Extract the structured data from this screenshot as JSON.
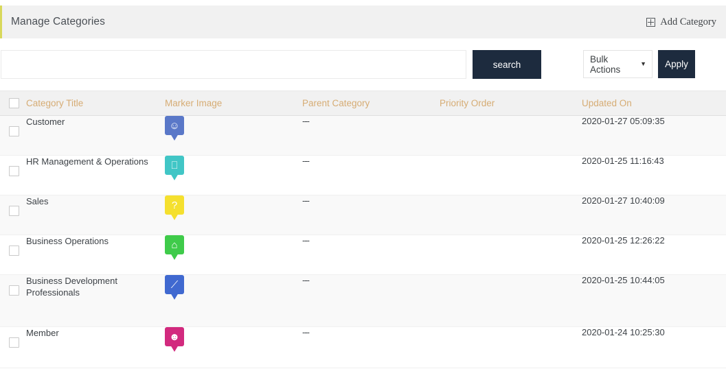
{
  "header": {
    "title": "Manage Categories",
    "add_label": "Add Category",
    "add_icon": "plus-square-icon",
    "accent_color": "#d8d85a",
    "bg_color": "#f1f1f1"
  },
  "filters": {
    "search_value": "",
    "search_placeholder": "",
    "search_button": "search",
    "bulk_actions_label": "Bulk Actions",
    "bulk_caret_icon": "chevron-down-icon",
    "apply_button": "Apply",
    "button_color": "#1d2b3e"
  },
  "table": {
    "header_text_color": "#d6ac74",
    "columns": [
      {
        "key": "select",
        "label": ""
      },
      {
        "key": "title",
        "label": "Category Title"
      },
      {
        "key": "marker",
        "label": "Marker Image"
      },
      {
        "key": "parent",
        "label": "Parent Category"
      },
      {
        "key": "priority",
        "label": "Priority Order"
      },
      {
        "key": "updated",
        "label": "Updated On"
      }
    ],
    "rows": [
      {
        "title": "Customer",
        "marker_icon": "pin-face-icon",
        "marker_color": "#5a78c8",
        "marker_glyph": "☺",
        "parent": "---",
        "priority": "",
        "updated": "2020-01-27 05:09:35"
      },
      {
        "title": "HR Management & Operations",
        "marker_icon": "pin-computer-icon",
        "marker_color": "#41c6c6",
        "marker_glyph": "⎕",
        "parent": "---",
        "priority": "",
        "updated": "2020-01-25 11:16:43"
      },
      {
        "title": "Sales",
        "marker_icon": "pin-question-people-icon",
        "marker_color": "#f5e02f",
        "marker_glyph": "?",
        "parent": "---",
        "priority": "",
        "updated": "2020-01-27 10:40:09"
      },
      {
        "title": "Business Operations",
        "marker_icon": "pin-building-icon",
        "marker_color": "#3fcb4a",
        "marker_glyph": "⌂",
        "parent": "---",
        "priority": "",
        "updated": "2020-01-25 12:26:22"
      },
      {
        "title": "Business Development Professionals",
        "marker_icon": "pin-chart-growth-icon",
        "marker_color": "#4069d0",
        "marker_glyph": "⟋",
        "parent": "---",
        "priority": "",
        "updated": "2020-01-25 10:44:05"
      },
      {
        "title": "Member",
        "marker_icon": "pin-theater-masks-icon",
        "marker_color": "#d22a7e",
        "marker_glyph": "☻",
        "parent": "---",
        "priority": "",
        "updated": "2020-01-24 10:25:30"
      }
    ]
  }
}
